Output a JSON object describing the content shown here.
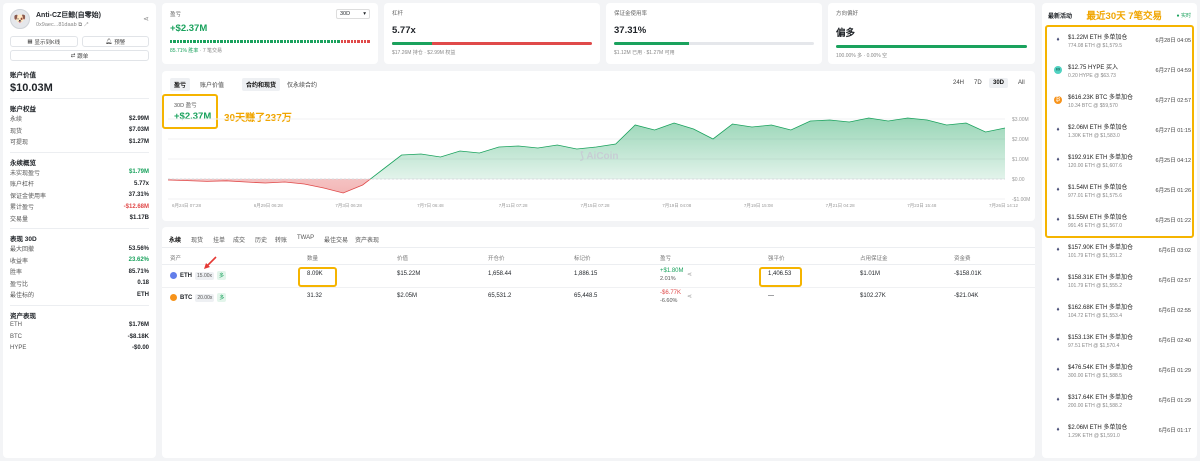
{
  "profile": {
    "name": "Anti-CZ巨鲸(自零始)",
    "address": "0x9aec...81daab",
    "btn_kline": "显示到K线",
    "btn_alert": "预警",
    "btn_follow": "跟单"
  },
  "account": {
    "value_label": "账户价值",
    "value": "$10.03M",
    "equity_title": "账户权益",
    "equity_rows": [
      {
        "k": "永续",
        "v": "$2.99M",
        "c": ""
      },
      {
        "k": "现货",
        "v": "$7.03M",
        "c": ""
      },
      {
        "k": "可提现",
        "v": "$1.27M",
        "c": ""
      }
    ],
    "perp_title": "永续概览",
    "perp_rows": [
      {
        "k": "未实现盈亏",
        "v": "$1.79M",
        "c": "green"
      },
      {
        "k": "账户杠杆",
        "v": "5.77x",
        "c": ""
      },
      {
        "k": "保证金使用率",
        "v": "37.31%",
        "c": ""
      },
      {
        "k": "累计盈亏",
        "v": "-$12.68M",
        "c": "red"
      },
      {
        "k": "交易量",
        "v": "$1.17B",
        "c": ""
      }
    ],
    "perf_title": "表现 30D",
    "perf_rows": [
      {
        "k": "最大回撤",
        "v": "53.56%",
        "c": ""
      },
      {
        "k": "收益率",
        "v": "23.62%",
        "c": "green"
      },
      {
        "k": "胜率",
        "v": "85.71%",
        "c": ""
      },
      {
        "k": "盈亏比",
        "v": "0.18",
        "c": ""
      },
      {
        "k": "最佳标的",
        "v": "ETH",
        "c": ""
      }
    ],
    "asset_title": "资产表现",
    "asset_rows": [
      {
        "k": "ETH",
        "v": "$1.76M",
        "c": ""
      },
      {
        "k": "BTC",
        "v": "-$8.18K",
        "c": ""
      },
      {
        "k": "HYPE",
        "v": "-$0.00",
        "c": ""
      }
    ]
  },
  "top": {
    "pnl": {
      "label": "盈亏",
      "period": "30D",
      "value": "+$2.37M",
      "sub1": "85.71% 胜率",
      "sub2": "7 笔交易",
      "win_ratio": 0.8571
    },
    "leverage": {
      "label": "杠杆",
      "value": "5.77x",
      "sub": "$17.26M 持仓 · $2.99M 权益",
      "long_ratio": 0.2
    },
    "margin": {
      "label": "保证金使用率",
      "value": "37.31%",
      "sub": "$1.12M 已用 · $1.27M 可用",
      "ratio": 0.3731
    },
    "direction": {
      "label": "方向偏好",
      "value": "偏多",
      "sub": "100.00% 多 · 0.00% 空",
      "ratio": 1.0
    }
  },
  "chart": {
    "tabs_left": [
      "盈亏",
      "账户价值"
    ],
    "tabs_mid": [
      "合约和现货",
      "仅永续合约"
    ],
    "periods": [
      "24H",
      "7D",
      "30D",
      "All"
    ],
    "active_period": "30D",
    "badge_label": "30D 盈亏",
    "badge_value": "+$2.37M",
    "annotation": "30天赚了237万",
    "watermark": "AiCoin",
    "y_ticks": [
      "$3.00M",
      "$2.00M",
      "$1.00M",
      "$0.00",
      "-$1.00M"
    ],
    "x_ticks": [
      "6月24日 07:28",
      "6月29日 06:28",
      "7月3日 06:28",
      "7月7日 06:48",
      "7月11日 07:28",
      "7月15日 07:28",
      "7月19日 04:08",
      "7月19日 15:08",
      "7月21日 04:28",
      "7月23日 15:48",
      "7月26日 14:12"
    ]
  },
  "chart_data": {
    "type": "area",
    "title": "30D 盈亏",
    "ylim": [
      -1000000,
      3500000
    ],
    "values": [
      -50000,
      -80000,
      -120000,
      -90000,
      -150000,
      -200000,
      -150000,
      -250000,
      -450000,
      -700000,
      -300000,
      450000,
      1200000,
      1250000,
      1100000,
      1400000,
      1300000,
      1600000,
      1650000,
      1550000,
      1700000,
      1500000,
      1600000,
      1750000,
      2700000,
      2450000,
      2800000,
      2500000,
      2000000,
      2750000,
      2600000,
      2700000,
      2450000,
      2900000,
      2950000,
      2850000,
      3050000,
      2900000,
      3050000,
      2950000,
      2700000,
      2800000,
      2350000,
      2550000
    ]
  },
  "positions": {
    "tabs": [
      "永续",
      "现货",
      "挂单",
      "成交",
      "历史",
      "转账",
      "TWAP",
      "最佳交易",
      "资产表现"
    ],
    "headers": [
      "资产",
      "数量",
      "价值",
      "开仓价",
      "标记价",
      "盈亏",
      "强平价",
      "占用保证金",
      "资金费"
    ],
    "rows": [
      {
        "asset": "ETH",
        "lev": "15.00x",
        "side": "多",
        "qty": "8.09K",
        "value": "$15.22M",
        "entry": "1,658.44",
        "mark": "1,886.15",
        "pnl": "+$1.80M",
        "pnl_pct": "2.01%",
        "pnl_c": "green",
        "liq": "1,406.53",
        "margin": "$1.01M",
        "funding": "-$158.01K",
        "color": "#627eea"
      },
      {
        "asset": "BTC",
        "lev": "20.00x",
        "side": "多",
        "qty": "31.32",
        "value": "$2.05M",
        "entry": "65,531.2",
        "mark": "65,448.5",
        "pnl": "-$6.77K",
        "pnl_pct": "-6.60%",
        "pnl_c": "red",
        "liq": "—",
        "margin": "$102.27K",
        "funding": "-$21.04K",
        "color": "#f7931a"
      }
    ]
  },
  "activity": {
    "title": "最新活动",
    "annotation": "最近30天 7笔交易",
    "live": "实时",
    "items": [
      {
        "t": "$1.22M ETH 多单加仓",
        "s": "774.08 ETH @ $1,579.5",
        "d": "6月28日 04:05",
        "icon": "eth",
        "hl": true
      },
      {
        "t": "$12.75 HYPE 买入",
        "s": "0.20 HYPE @ $63.73",
        "d": "6月27日 04:59",
        "icon": "hype",
        "hl": true
      },
      {
        "t": "$616.23K BTC 多单加仓",
        "s": "10.34 BTC @ $59,570",
        "d": "6月27日 02:57",
        "icon": "btc",
        "hl": true
      },
      {
        "t": "$2.06M ETH 多单加仓",
        "s": "1.30K ETH @ $1,583.0",
        "d": "6月27日 01:15",
        "icon": "eth",
        "hl": true
      },
      {
        "t": "$192.91K ETH 多单加仓",
        "s": "120.00 ETH @ $1,607.6",
        "d": "6月25日 04:12",
        "icon": "eth",
        "hl": true
      },
      {
        "t": "$1.54M ETH 多单加仓",
        "s": "977.01 ETH @ $1,575.6",
        "d": "6月25日 01:26",
        "icon": "eth",
        "hl": true
      },
      {
        "t": "$1.55M ETH 多单加仓",
        "s": "991.45 ETH @ $1,567.0",
        "d": "6月25日 01:22",
        "icon": "eth",
        "hl": true
      },
      {
        "t": "$157.90K ETH 多单加仓",
        "s": "101.79 ETH @ $1,551.2",
        "d": "6月6日 03:02",
        "icon": "eth",
        "hl": false
      },
      {
        "t": "$158.31K ETH 多单加仓",
        "s": "101.79 ETH @ $1,555.2",
        "d": "6月6日 02:57",
        "icon": "eth",
        "hl": false
      },
      {
        "t": "$162.68K ETH 多单加仓",
        "s": "104.72 ETH @ $1,553.4",
        "d": "6月6日 02:55",
        "icon": "eth",
        "hl": false
      },
      {
        "t": "$153.13K ETH 多单加仓",
        "s": "97.51 ETH @ $1,570.4",
        "d": "6月6日 02:40",
        "icon": "eth",
        "hl": false
      },
      {
        "t": "$476.54K ETH 多单加仓",
        "s": "300.00 ETH @ $1,588.5",
        "d": "6月6日 01:29",
        "icon": "eth",
        "hl": false
      },
      {
        "t": "$317.64K ETH 多单加仓",
        "s": "200.00 ETH @ $1,588.2",
        "d": "6月6日 01:29",
        "icon": "eth",
        "hl": false
      },
      {
        "t": "$2.06M ETH 多单加仓",
        "s": "1.29K ETH @ $1,591.0",
        "d": "6月6日 01:17",
        "icon": "eth",
        "hl": false
      }
    ]
  },
  "colors": {
    "green": "#1aa25d",
    "red": "#e04a4a",
    "highlight": "#f5b400",
    "eth": "#627eea",
    "btc": "#f7931a",
    "hype": "#50d2c1"
  }
}
